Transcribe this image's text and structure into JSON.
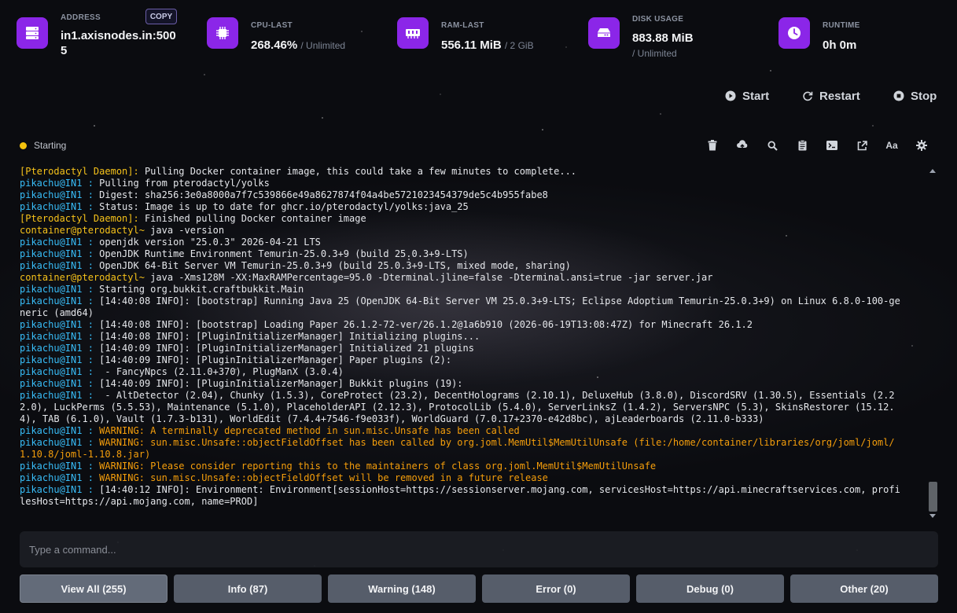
{
  "stats": {
    "address": {
      "label": "ADDRESS",
      "value": "in1.axisnodes.in:5005",
      "copy_label": "COPY",
      "icon": "server-icon"
    },
    "cpu": {
      "label": "CPU-LAST",
      "value": "268.46%",
      "limit": "/ Unlimited",
      "icon": "cpu-chip-icon"
    },
    "ram": {
      "label": "RAM-LAST",
      "value": "556.11 MiB",
      "limit": "/ 2 GiB",
      "icon": "memory-icon"
    },
    "disk": {
      "label": "DISK USAGE",
      "value": "883.88 MiB",
      "limit": "/ Unlimited",
      "icon": "hard-drive-icon"
    },
    "runtime": {
      "label": "RUNTIME",
      "value": "0h 0m",
      "icon": "clock-icon"
    }
  },
  "controls": {
    "start": "Start",
    "restart": "Restart",
    "stop": "Stop"
  },
  "status": {
    "text": "Starting",
    "color": "#f4c20d"
  },
  "console": {
    "lines": [
      {
        "prefix": "[Pterodactyl Daemon]:",
        "kind": "daemon",
        "text": " Pulling Docker container image, this could take a few minutes to complete..."
      },
      {
        "prefix": "pikachu@IN1 :",
        "kind": "pika",
        "text": " Pulling from pterodactyl/yolks"
      },
      {
        "prefix": "pikachu@IN1 :",
        "kind": "pika",
        "text": " Digest: sha256:3e0a8000a7f7c539866e49a8627874f04a4be5721023454379de5c4b955fabe8"
      },
      {
        "prefix": "pikachu@IN1 :",
        "kind": "pika",
        "text": " Status: Image is up to date for ghcr.io/pterodactyl/yolks:java_25"
      },
      {
        "prefix": "[Pterodactyl Daemon]:",
        "kind": "daemon",
        "text": " Finished pulling Docker container image"
      },
      {
        "prefix": "container@pterodactyl~",
        "kind": "container",
        "text": " java -version"
      },
      {
        "prefix": "pikachu@IN1 :",
        "kind": "pika",
        "text": " openjdk version \"25.0.3\" 2026-04-21 LTS"
      },
      {
        "prefix": "pikachu@IN1 :",
        "kind": "pika",
        "text": " OpenJDK Runtime Environment Temurin-25.0.3+9 (build 25.0.3+9-LTS)"
      },
      {
        "prefix": "pikachu@IN1 :",
        "kind": "pika",
        "text": " OpenJDK 64-Bit Server VM Temurin-25.0.3+9 (build 25.0.3+9-LTS, mixed mode, sharing)"
      },
      {
        "prefix": "container@pterodactyl~",
        "kind": "container",
        "text": " java -Xms128M -XX:MaxRAMPercentage=95.0 -Dterminal.jline=false -Dterminal.ansi=true -jar server.jar"
      },
      {
        "prefix": "pikachu@IN1 :",
        "kind": "pika",
        "text": " Starting org.bukkit.craftbukkit.Main"
      },
      {
        "prefix": "pikachu@IN1 :",
        "kind": "pika",
        "text": " [14:40:08 INFO]: [bootstrap] Running Java 25 (OpenJDK 64-Bit Server VM 25.0.3+9-LTS; Eclipse Adoptium Temurin-25.0.3+9) on Linux 6.8.0-100-generic (amd64)"
      },
      {
        "prefix": "pikachu@IN1 :",
        "kind": "pika",
        "text": " [14:40:08 INFO]: [bootstrap] Loading Paper 26.1.2-72-ver/26.1.2@1a6b910 (2026-06-19T13:08:47Z) for Minecraft 26.1.2"
      },
      {
        "prefix": "pikachu@IN1 :",
        "kind": "pika",
        "text": " [14:40:08 INFO]: [PluginInitializerManager] Initializing plugins..."
      },
      {
        "prefix": "pikachu@IN1 :",
        "kind": "pika",
        "text": " [14:40:09 INFO]: [PluginInitializerManager] Initialized 21 plugins"
      },
      {
        "prefix": "pikachu@IN1 :",
        "kind": "pika",
        "text": " [14:40:09 INFO]: [PluginInitializerManager] Paper plugins (2):"
      },
      {
        "prefix": "pikachu@IN1 :",
        "kind": "pika",
        "text": "  - FancyNpcs (2.11.0+370), PlugManX (3.0.4)"
      },
      {
        "prefix": "pikachu@IN1 :",
        "kind": "pika",
        "text": " [14:40:09 INFO]: [PluginInitializerManager] Bukkit plugins (19):"
      },
      {
        "prefix": "pikachu@IN1 :",
        "kind": "pika",
        "text": "  - AltDetector (2.04), Chunky (1.5.3), CoreProtect (23.2), DecentHolograms (2.10.1), DeluxeHub (3.8.0), DiscordSRV (1.30.5), Essentials (2.22.0), LuckPerms (5.5.53), Maintenance (5.1.0), PlaceholderAPI (2.12.3), ProtocolLib (5.4.0), ServerLinksZ (1.4.2), ServersNPC (5.3), SkinsRestorer (15.12.4), TAB (6.1.0), Vault (1.7.3-b131), WorldEdit (7.4.4+7546-f9e033f), WorldGuard (7.0.17+2370-e42d8bc), ajLeaderboards (2.11.0-b333)"
      },
      {
        "prefix": "pikachu@IN1 :",
        "kind": "pika",
        "warn": true,
        "text": " WARNING: A terminally deprecated method in sun.misc.Unsafe has been called"
      },
      {
        "prefix": "pikachu@IN1 :",
        "kind": "pika",
        "warn": true,
        "text": " WARNING: sun.misc.Unsafe::objectFieldOffset has been called by org.joml.MemUtil$MemUtilUnsafe (file:/home/container/libraries/org/joml/joml/1.10.8/joml-1.10.8.jar)"
      },
      {
        "prefix": "pikachu@IN1 :",
        "kind": "pika",
        "warn": true,
        "text": " WARNING: Please consider reporting this to the maintainers of class org.joml.MemUtil$MemUtilUnsafe"
      },
      {
        "prefix": "pikachu@IN1 :",
        "kind": "pika",
        "warn": true,
        "text": " WARNING: sun.misc.Unsafe::objectFieldOffset will be removed in a future release"
      },
      {
        "prefix": "pikachu@IN1 :",
        "kind": "pika",
        "text": " [14:40:12 INFO]: Environment: Environment[sessionHost=https://sessionserver.mojang.com, servicesHost=https://api.minecraftservices.com, profilesHost=https://api.mojang.com, name=PROD]"
      }
    ]
  },
  "command_input": {
    "placeholder": "Type a command..."
  },
  "filters": [
    {
      "label": "View All (255)",
      "name": "filter-view-all"
    },
    {
      "label": "Info (87)",
      "name": "filter-info"
    },
    {
      "label": "Warning (148)",
      "name": "filter-warning"
    },
    {
      "label": "Error (0)",
      "name": "filter-error"
    },
    {
      "label": "Debug (0)",
      "name": "filter-debug"
    },
    {
      "label": "Other (20)",
      "name": "filter-other"
    }
  ],
  "toolbar": [
    "trash-icon",
    "cloud-upload-icon",
    "search-icon",
    "clipboard-icon",
    "terminal-icon",
    "external-link-icon",
    "font-size-icon",
    "settings-gear-icon"
  ],
  "toolbar_font_glyph": "Aa",
  "colors": {
    "accent": "#8b26e8",
    "prompt": "#38bdf8",
    "daemon": "#f6c21a",
    "warning": "#f59e0b"
  }
}
